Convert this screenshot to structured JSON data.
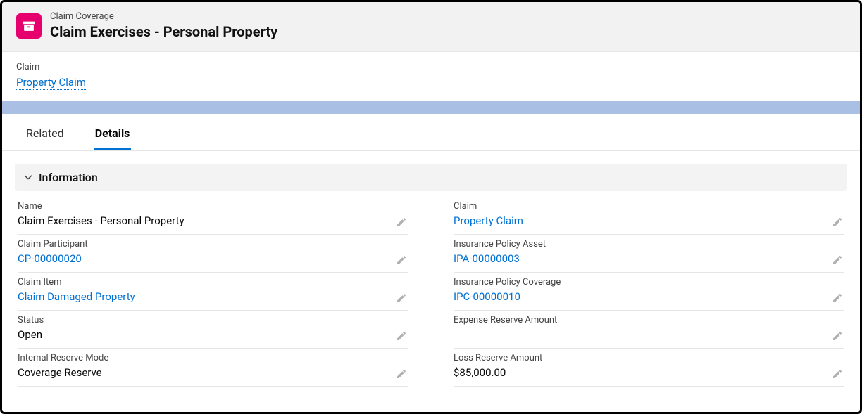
{
  "header": {
    "object_label": "Claim Coverage",
    "record_title": "Claim Exercises - Personal Property"
  },
  "highlights": {
    "label": "Claim",
    "link_text": "Property Claim"
  },
  "tabs": [
    {
      "label": "Related",
      "active": false
    },
    {
      "label": "Details",
      "active": true
    }
  ],
  "section": {
    "title": "Information"
  },
  "fields": {
    "left": [
      {
        "label": "Name",
        "value": "Claim Exercises - Personal Property",
        "link": false
      },
      {
        "label": "Claim Participant",
        "value": "CP-00000020",
        "link": true
      },
      {
        "label": "Claim Item",
        "value": "Claim Damaged Property",
        "link": true
      },
      {
        "label": "Status",
        "value": "Open",
        "link": false
      },
      {
        "label": "Internal Reserve Mode",
        "value": "Coverage Reserve",
        "link": false
      }
    ],
    "right": [
      {
        "label": "Claim",
        "value": "Property Claim",
        "link": true
      },
      {
        "label": "Insurance Policy Asset",
        "value": "IPA-00000003",
        "link": true
      },
      {
        "label": "Insurance Policy Coverage",
        "value": "IPC-00000010",
        "link": true
      },
      {
        "label": "Expense Reserve Amount",
        "value": "",
        "link": false
      },
      {
        "label": "Loss Reserve Amount",
        "value": "$85,000.00",
        "link": false
      }
    ]
  }
}
